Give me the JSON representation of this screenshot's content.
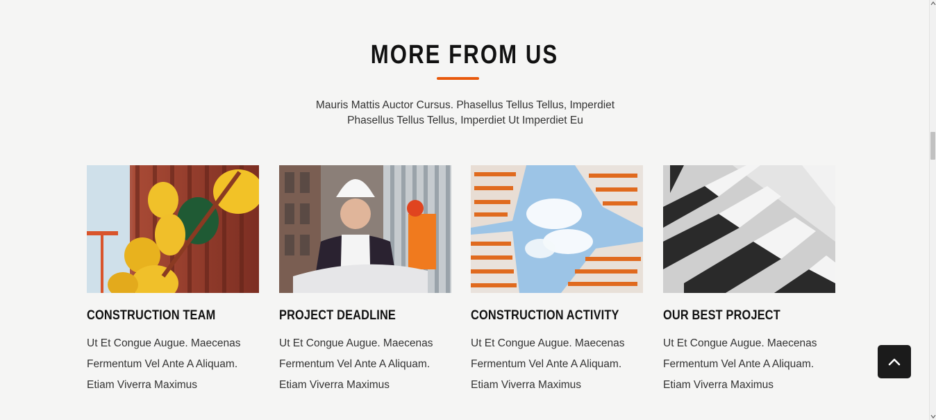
{
  "section": {
    "title": "MORE FROM US",
    "intro_line1": "Mauris Mattis Auctor Cursus. Phasellus Tellus Tellus, Imperdiet",
    "intro_line2": "Phasellus Tellus Tellus, Imperdiet Ut Imperdiet Eu"
  },
  "colors": {
    "accent": "#e8590c",
    "background": "#f5f5f4",
    "button": "#1b1b1b"
  },
  "cards": [
    {
      "image": "construction-helmets-photo",
      "title": "CONSTRUCTION TEAM",
      "text_line1": "Ut Et Congue Augue. Maecenas",
      "text_line2": "Fermentum Vel Ante A Aliquam.",
      "text_line3": "Etiam Viverra Maximus"
    },
    {
      "image": "engineer-with-blueprint-photo",
      "title": "PROJECT DEADLINE",
      "text_line1": "Ut Et Congue Augue. Maecenas",
      "text_line2": "Fermentum Vel Ante A Aliquam.",
      "text_line3": "Etiam Viverra Maximus"
    },
    {
      "image": "buildings-sky-view-photo",
      "title": "CONSTRUCTION ACTIVITY",
      "text_line1": "Ut Et Congue Augue. Maecenas",
      "text_line2": "Fermentum Vel Ante A Aliquam.",
      "text_line3": "Etiam Viverra Maximus"
    },
    {
      "image": "modern-building-bw-photo",
      "title": "OUR BEST PROJECT",
      "text_line1": "Ut Et Congue Augue. Maecenas",
      "text_line2": "Fermentum Vel Ante A Aliquam.",
      "text_line3": "Etiam Viverra Maximus"
    }
  ],
  "back_to_top": {
    "icon": "chevron-up-icon"
  }
}
